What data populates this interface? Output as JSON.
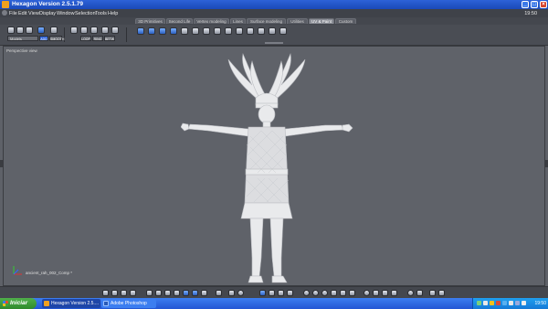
{
  "window": {
    "title": "Hexagon Version 2.5.1.79",
    "clock": "19:50"
  },
  "menu": [
    "File",
    "Edit",
    "View",
    "Display",
    "Window",
    "Selection",
    "Tools",
    "Help"
  ],
  "tabs": [
    "3D Primitives",
    "Second Life",
    "Vertex modeling",
    "Lines",
    "Surface modeling",
    "Utilities",
    "UV & Paint",
    "Custom"
  ],
  "active_tab": "UV & Paint",
  "toolbar": {
    "preset_value": "Models",
    "small_buttons_row1": [
      "ADD",
      "SMOOTH"
    ],
    "small_buttons_row2": [
      "LOOP",
      "RING",
      "BETW"
    ]
  },
  "viewport": {
    "label": "Perspective view",
    "object_name": "ancient_rah_002_Comp *"
  },
  "taskbar": {
    "start_label": "Iniciar",
    "tasks": [
      "Hexagon Version 2.5....",
      "Adobe Photoshop"
    ],
    "clock": "19:50"
  },
  "colors": {
    "titlebar": "#2356d4",
    "viewport_bg": "#5f6269",
    "start_button": "#3a9a35",
    "figure": "#e9eaec"
  }
}
